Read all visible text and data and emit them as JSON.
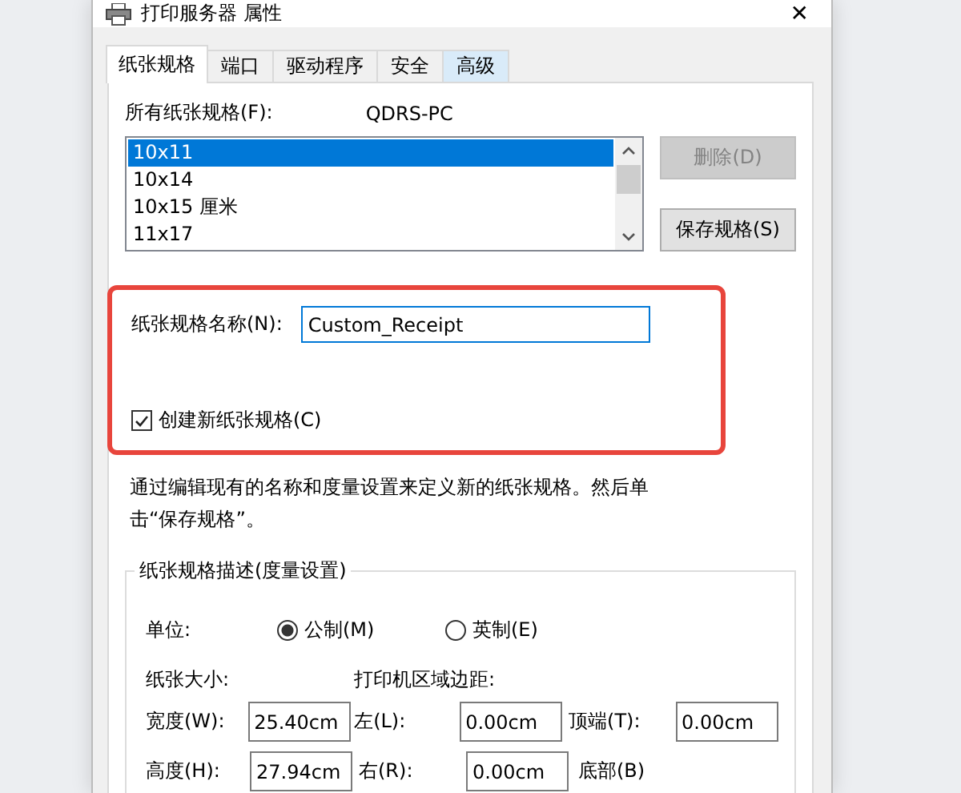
{
  "window": {
    "title": "打印服务器 属性",
    "close": "✕"
  },
  "tabs": [
    {
      "label": "纸张规格",
      "selected": true,
      "hover": false
    },
    {
      "label": "端口",
      "selected": false,
      "hover": false
    },
    {
      "label": "驱动程序",
      "selected": false,
      "hover": false
    },
    {
      "label": "安全",
      "selected": false,
      "hover": false
    },
    {
      "label": "高级",
      "selected": false,
      "hover": true
    }
  ],
  "forms": {
    "label": "所有纸张规格(F):",
    "server": "QDRS-PC",
    "items": [
      {
        "label": "10x11",
        "selected": true
      },
      {
        "label": "10x14",
        "selected": false
      },
      {
        "label": "10x15 厘米",
        "selected": false
      },
      {
        "label": "11x17",
        "selected": false
      }
    ],
    "buttons": [
      {
        "label": "删除(D)",
        "disabled": true
      },
      {
        "label": "保存规格(S)",
        "disabled": false
      }
    ]
  },
  "highlight": {
    "name_label": "纸张规格名称(N):",
    "name_value": "Custom_Receipt",
    "create": {
      "label": "创建新纸张规格(C)",
      "checked": true
    }
  },
  "hint": "通过编辑现有的名称和度量设置来定义新的纸张规格。然后单击“保存规格”。",
  "group": {
    "title": "纸张规格描述(度量设置)",
    "units_label": "单位:",
    "units": [
      {
        "label": "公制(M)",
        "selected": true
      },
      {
        "label": "英制(E)",
        "selected": false
      }
    ],
    "size_label": "纸张大小:",
    "margins_label": "打印机区域边距:",
    "rows": [
      {
        "size_label": "宽度(W):",
        "size": "25.40cm",
        "m1_label": "左(L):",
        "m1": "0.00cm",
        "m2_label": "顶端(T):",
        "m2": "0.00cm"
      },
      {
        "size_label": "高度(H):",
        "size": "27.94cm",
        "m1_label": "右(R):",
        "m1": "0.00cm",
        "m2_label": "底部(B)"
      }
    ]
  }
}
